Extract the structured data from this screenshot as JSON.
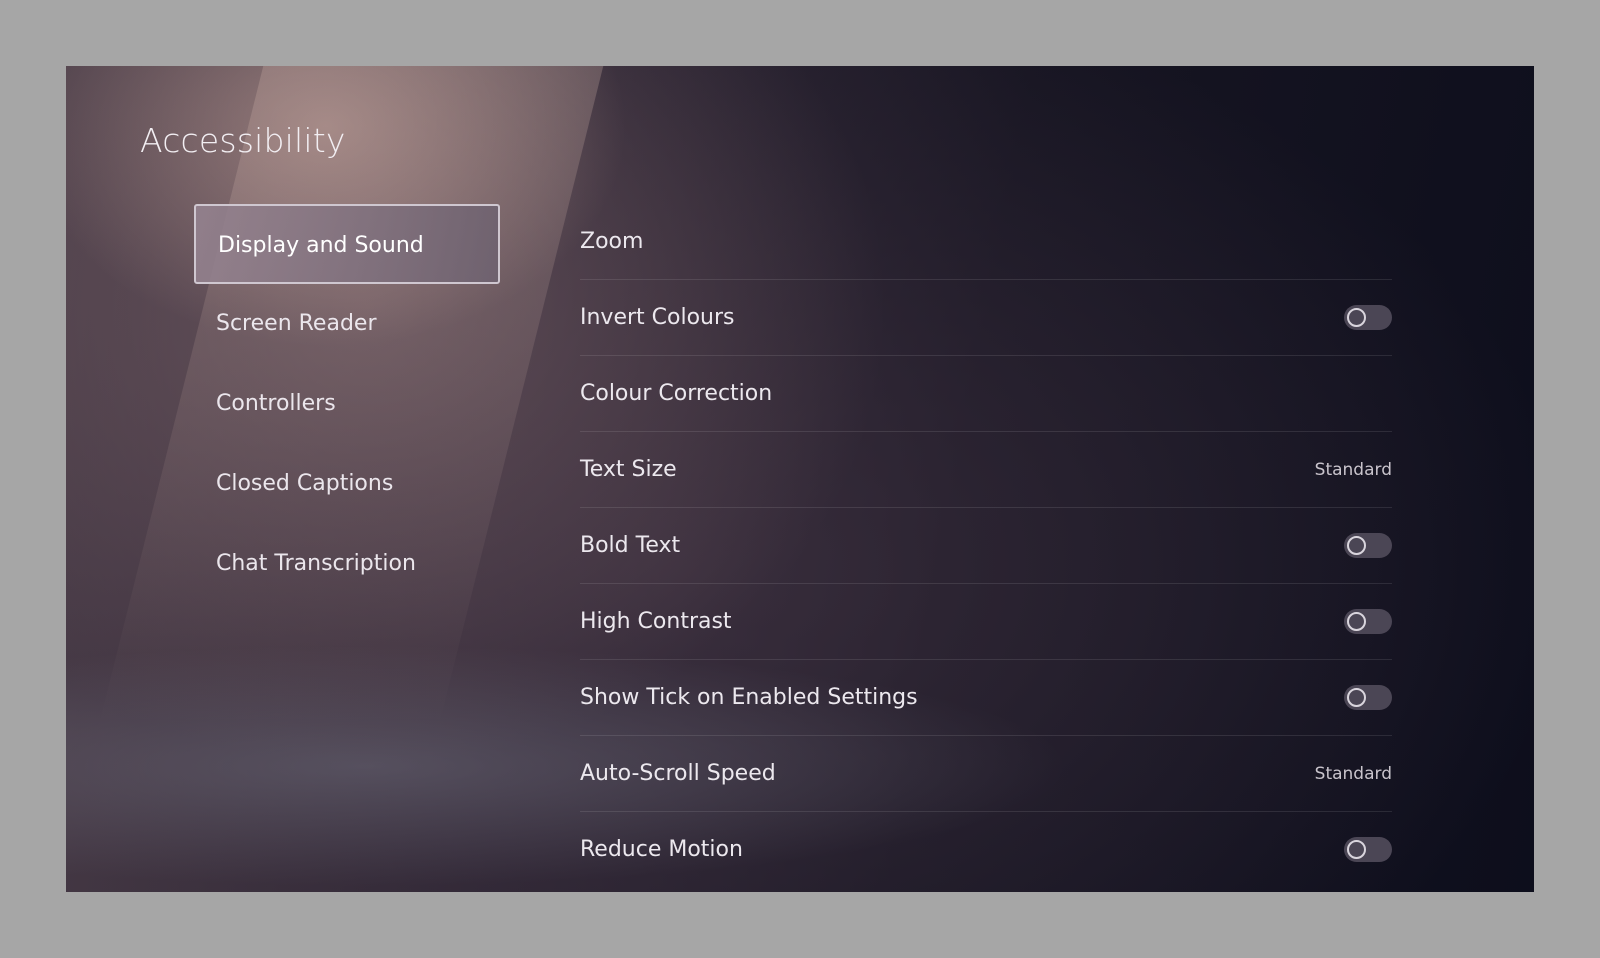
{
  "page": {
    "title": "Accessibility"
  },
  "sidebar": {
    "items": [
      {
        "label": "Display and Sound",
        "selected": true
      },
      {
        "label": "Screen Reader",
        "selected": false
      },
      {
        "label": "Controllers",
        "selected": false
      },
      {
        "label": "Closed Captions",
        "selected": false
      },
      {
        "label": "Chat Transcription",
        "selected": false
      }
    ]
  },
  "settings": {
    "items": [
      {
        "label": "Zoom",
        "control": "none"
      },
      {
        "label": "Invert Colours",
        "control": "toggle",
        "on": false
      },
      {
        "label": "Colour Correction",
        "control": "none"
      },
      {
        "label": "Text Size",
        "control": "value",
        "value": "Standard"
      },
      {
        "label": "Bold Text",
        "control": "toggle",
        "on": false
      },
      {
        "label": "High Contrast",
        "control": "toggle",
        "on": false
      },
      {
        "label": "Show Tick on Enabled Settings",
        "control": "toggle",
        "on": false
      },
      {
        "label": "Auto-Scroll Speed",
        "control": "value",
        "value": "Standard"
      },
      {
        "label": "Reduce Motion",
        "control": "toggle",
        "on": false
      }
    ]
  }
}
